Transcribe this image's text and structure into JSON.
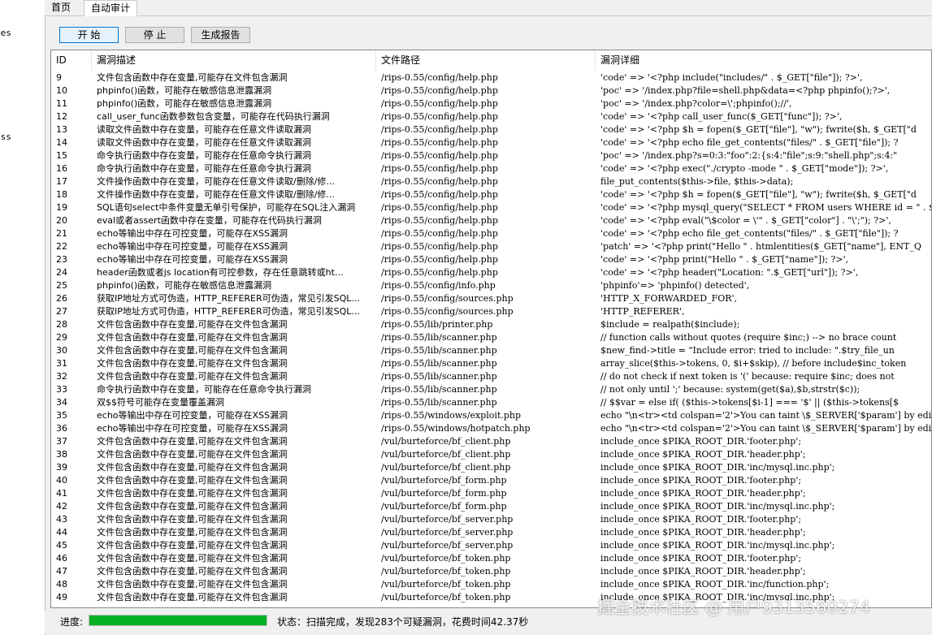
{
  "left_strip": {
    "fragments": [
      "tes",
      "ess"
    ]
  },
  "tabs": [
    {
      "label": "首页"
    },
    {
      "label": "自动审计"
    }
  ],
  "toolbar": {
    "start_label": "开 始",
    "stop_label": "停 止",
    "report_label": "生成报告"
  },
  "table": {
    "headers": {
      "id": "ID",
      "desc": "漏洞描述",
      "path": "文件路径",
      "detail": "漏洞详细"
    },
    "rows": [
      [
        "9",
        "文件包含函数中存在变量,可能存在文件包含漏洞",
        "/rips-0.55/config/help.php",
        "'code' => '<?php include(\"includes/\" . $_GET[\"file\"]); ?>',"
      ],
      [
        "10",
        "phpinfo()函数，可能存在敏感信息泄露漏洞",
        "/rips-0.55/config/help.php",
        "'poc' => '/index.php?file=shell.php&data=<?php phpinfo();?>',"
      ],
      [
        "11",
        "phpinfo()函数，可能存在敏感信息泄露漏洞",
        "/rips-0.55/config/help.php",
        "'poc' => '/index.php?color=\\';phpinfo();//',"
      ],
      [
        "12",
        "call_user_func函数参数包含变量，可能存在代码执行漏洞",
        "/rips-0.55/config/help.php",
        "'code' => '<?php call_user_func($_GET[\"func\"]); ?>',"
      ],
      [
        "13",
        "读取文件函数中存在变量，可能存在任意文件读取漏洞",
        "/rips-0.55/config/help.php",
        "'code' => '<?php $h = fopen($_GET[\"file\"], \"w\"); fwrite($h, $_GET[\"d"
      ],
      [
        "14",
        "读取文件函数中存在变量，可能存在任意文件读取漏洞",
        "/rips-0.55/config/help.php",
        "'code' => '<?php echo file_get_contents(\"files/\" . $_GET[\"file\"]); ?"
      ],
      [
        "15",
        "命令执行函数中存在变量，可能存在任意命令执行漏洞",
        "/rips-0.55/config/help.php",
        "'poc' => '/index.php?s=0:3:\"foo\":2:{s:4:\"file\";s:9:\"shell.php\";s:4:\""
      ],
      [
        "16",
        "命令执行函数中存在变量，可能存在任意命令执行漏洞",
        "/rips-0.55/config/help.php",
        "'code' => '<?php exec(\"./crypto -mode \" . $_GET[\"mode\"]); ?>',"
      ],
      [
        "17",
        "文件操作函数中存在变量，可能存在任意文件读取/删除/修...",
        "/rips-0.55/config/help.php",
        "file_put_contents($this->file, $this->data);"
      ],
      [
        "18",
        "文件操作函数中存在变量，可能存在任意文件读取/删除/修...",
        "/rips-0.55/config/help.php",
        "'code' => '<?php $h = fopen($_GET[\"file\"], \"w\"); fwrite($h, $_GET[\"d"
      ],
      [
        "19",
        "SQL语句select中条件变量无单引号保护，可能存在SQL注入漏洞",
        "/rips-0.55/config/help.php",
        "'code' => '<?php mysql_query(\"SELECT * FROM users WHERE id = \" . $_G"
      ],
      [
        "20",
        "eval或者assert函数中存在变量，可能存在代码执行漏洞",
        "/rips-0.55/config/help.php",
        "'code' => '<?php eval(\"\\$color = \\'\" . $_GET[\"color\"] . \"\\';\"); ?>',"
      ],
      [
        "21",
        "echo等输出中存在可控变量，可能存在XSS漏洞",
        "/rips-0.55/config/help.php",
        "'code' => '<?php echo file_get_contents(\"files/\" . $_GET[\"file\"]); ?"
      ],
      [
        "22",
        "echo等输出中存在可控变量，可能存在XSS漏洞",
        "/rips-0.55/config/help.php",
        "'patch' => '<?php print(\"Hello \" . htmlentities($_GET[\"name\"], ENT_Q"
      ],
      [
        "23",
        "echo等输出中存在可控变量，可能存在XSS漏洞",
        "/rips-0.55/config/help.php",
        "'code' => '<?php print(\"Hello \" . $_GET[\"name\"]); ?>',"
      ],
      [
        "24",
        "header函数或者js location有可控参数，存在任意跳转或ht...",
        "/rips-0.55/config/help.php",
        "'code' => '<?php header(\"Location: \".$_GET[\"url\"]); ?>',"
      ],
      [
        "25",
        "phpinfo()函数，可能存在敏感信息泄露漏洞",
        "/rips-0.55/config/info.php",
        "'phpinfo'=> 'phpinfo() detected',"
      ],
      [
        "26",
        "获取IP地址方式可伪造，HTTP_REFERER可伪造，常见引发SQL...",
        "/rips-0.55/config/sources.php",
        "'HTTP_X_FORWARDED_FOR',"
      ],
      [
        "27",
        "获取IP地址方式可伪造，HTTP_REFERER可伪造，常见引发SQL...",
        "/rips-0.55/config/sources.php",
        "'HTTP_REFERER',"
      ],
      [
        "28",
        "文件包含函数中存在变量,可能存在文件包含漏洞",
        "/rips-0.55/lib/printer.php",
        "$include = realpath($include);"
      ],
      [
        "29",
        "文件包含函数中存在变量,可能存在文件包含漏洞",
        "/rips-0.55/lib/scanner.php",
        "// function calls without quotes (require $inc;) --> no brace count"
      ],
      [
        "30",
        "文件包含函数中存在变量,可能存在文件包含漏洞",
        "/rips-0.55/lib/scanner.php",
        "$new_find->title = \"Include error: tried to include: \".$try_file_un"
      ],
      [
        "31",
        "文件包含函数中存在变量,可能存在文件包含漏洞",
        "/rips-0.55/lib/scanner.php",
        "array_slice($this->tokens, 0, $i+$skip), // before include$inc_token"
      ],
      [
        "32",
        "文件包含函数中存在变量,可能存在文件包含漏洞",
        "/rips-0.55/lib/scanner.php",
        "// do not check if next token is '(' because: require $inc; does not"
      ],
      [
        "33",
        "命令执行函数中存在变量，可能存在任意命令执行漏洞",
        "/rips-0.55/lib/scanner.php",
        "// not only until ';' because: system(get($a),$b,strstr($c));"
      ],
      [
        "34",
        "双$$符号可能存在变量覆盖漏洞",
        "/rips-0.55/lib/scanner.php",
        "// $$var = else if( ($this->tokens[$i-1] === '$' || ($this->tokens[$"
      ],
      [
        "35",
        "echo等输出中存在可控变量，可能存在XSS漏洞",
        "/rips-0.55/windows/exploit.php",
        "echo \"\\n<tr><td colspan='2'>You can taint \\$_SERVER['$param'] by edi"
      ],
      [
        "36",
        "echo等输出中存在可控变量，可能存在XSS漏洞",
        "/rips-0.55/windows/hotpatch.php",
        "echo \"\\n<tr><td colspan='2'>You can taint \\$_SERVER['$param'] by edi"
      ],
      [
        "37",
        "文件包含函数中存在变量,可能存在文件包含漏洞",
        "/vul/burteforce/bf_client.php",
        "include_once $PIKA_ROOT_DIR.'footer.php';"
      ],
      [
        "38",
        "文件包含函数中存在变量,可能存在文件包含漏洞",
        "/vul/burteforce/bf_client.php",
        "include_once $PIKA_ROOT_DIR.'header.php';"
      ],
      [
        "39",
        "文件包含函数中存在变量,可能存在文件包含漏洞",
        "/vul/burteforce/bf_client.php",
        "include_once $PIKA_ROOT_DIR.'inc/mysql.inc.php';"
      ],
      [
        "40",
        "文件包含函数中存在变量,可能存在文件包含漏洞",
        "/vul/burteforce/bf_form.php",
        "include_once $PIKA_ROOT_DIR.'footer.php';"
      ],
      [
        "41",
        "文件包含函数中存在变量,可能存在文件包含漏洞",
        "/vul/burteforce/bf_form.php",
        "include_once $PIKA_ROOT_DIR.'header.php';"
      ],
      [
        "42",
        "文件包含函数中存在变量,可能存在文件包含漏洞",
        "/vul/burteforce/bf_form.php",
        "include_once $PIKA_ROOT_DIR.'inc/mysql.inc.php';"
      ],
      [
        "43",
        "文件包含函数中存在变量,可能存在文件包含漏洞",
        "/vul/burteforce/bf_server.php",
        "include_once $PIKA_ROOT_DIR.'footer.php';"
      ],
      [
        "44",
        "文件包含函数中存在变量,可能存在文件包含漏洞",
        "/vul/burteforce/bf_server.php",
        "include_once $PIKA_ROOT_DIR.'header.php';"
      ],
      [
        "45",
        "文件包含函数中存在变量,可能存在文件包含漏洞",
        "/vul/burteforce/bf_server.php",
        "include_once $PIKA_ROOT_DIR.'inc/mysql.inc.php';"
      ],
      [
        "46",
        "文件包含函数中存在变量,可能存在文件包含漏洞",
        "/vul/burteforce/bf_token.php",
        "include_once $PIKA_ROOT_DIR.'footer.php';"
      ],
      [
        "47",
        "文件包含函数中存在变量,可能存在文件包含漏洞",
        "/vul/burteforce/bf_token.php",
        "include_once $PIKA_ROOT_DIR.'header.php';"
      ],
      [
        "48",
        "文件包含函数中存在变量,可能存在文件包含漏洞",
        "/vul/burteforce/bf_token.php",
        "include_once $PIKA_ROOT_DIR.'inc/function.php';"
      ],
      [
        "49",
        "文件包含函数中存在变量,可能存在文件包含漏洞",
        "/vul/burteforce/bf_token.php",
        "include_once $PIKA_ROOT_DIR.'inc/mysql.inc.php';"
      ]
    ]
  },
  "status": {
    "progress_label": "进度:",
    "progress_fraction": 1.0,
    "status_text": "状态：扫描完成，发现283个可疑漏洞，花费时间42.37秒",
    "progress_color": "#06b025"
  },
  "watermark": "掘金技术社区 @ 用户9313560274"
}
